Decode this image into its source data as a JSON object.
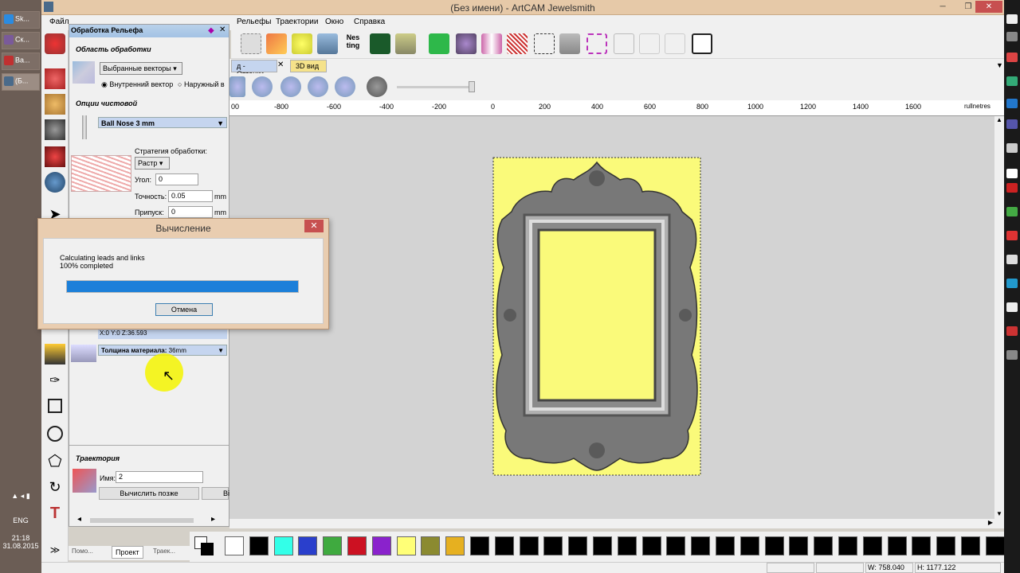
{
  "window": {
    "title": "(Без имени) - ArtCAM Jewelsmith"
  },
  "menu": [
    "Файл",
    "Рельефы",
    "Траектории",
    "Окно",
    "Справка"
  ],
  "taskbar": {
    "items": [
      {
        "label": "Sk...",
        "color": "#2b8be0"
      },
      {
        "label": "Ск...",
        "color": "#7a5a9a"
      },
      {
        "label": "Ва...",
        "color": "#c03030"
      },
      {
        "label": "(Б...",
        "color": "#4a6a8a"
      }
    ],
    "language": "ENG",
    "time": "21:18",
    "date": "31.08.2015"
  },
  "tabs": {
    "shades": "д - Оттенки",
    "view3d": "3D вид"
  },
  "ruler": {
    "ticks": [
      "00",
      "-800",
      "-600",
      "-400",
      "-200",
      "0",
      "200",
      "400",
      "600",
      "800",
      "1000",
      "1200",
      "1400",
      "1600"
    ],
    "unit_label": "rullnetres"
  },
  "panel": {
    "title": "Обработка Рельефа",
    "area_heading": "Область обработки",
    "area_select": "Выбранные векторы",
    "radio_inner": "Внутренний вектор",
    "radio_outer": "Наружный в",
    "finish_heading": "Опции чистовой",
    "tool_name": "Ball Nose 3 mm",
    "strategy_label": "Стратегия обработки:",
    "strategy_value": "Растр",
    "angle_label": "Угол:",
    "angle_value": "0",
    "tolerance_label": "Точность:",
    "tolerance_value": "0.05",
    "tolerance_unit": "mm",
    "allowance_label": "Припуск:",
    "allowance_value": "0",
    "allowance_unit": "mm",
    "coords": "X:0 Y:0 Z:36.593",
    "thickness_label": "Толщина материала:",
    "thickness_value": "36mm",
    "toolpath_heading": "Траектория",
    "name_label": "Имя:",
    "name_value": "2",
    "calc_later_button": "Вычислить позже",
    "calc_button_partial": "Ві"
  },
  "panel_tabs": [
    "Помо...",
    "Проект",
    "Траек..."
  ],
  "dialog": {
    "title": "Вычисление",
    "message_line1": "Calculating leads and links",
    "message_line2": "100% completed",
    "progress": 1.0,
    "cancel_button": "Отмена",
    "accent": "#1c7fd9"
  },
  "status": {
    "width": "W: 758.040",
    "height": "H: 1177.122"
  },
  "palette": {
    "colors": [
      "#ffffff",
      "#000000",
      "#33ffe8",
      "#2a3fcc",
      "#3faa3f",
      "#cc1122",
      "#8a22cc",
      "#ffff77",
      "#8b8a30",
      "#e6b020",
      "#000000",
      "#000000",
      "#000000",
      "#000000",
      "#000000",
      "#000000",
      "#000000",
      "#000000",
      "#000000",
      "#000000",
      "#000000",
      "#000000",
      "#000000",
      "#000000",
      "#000000",
      "#000000",
      "#000000",
      "#000000",
      "#000000",
      "#000000",
      "#000000",
      "#000000"
    ]
  },
  "canvas": {
    "background": "#d3d3d3",
    "material_color": "#fafa7a",
    "frame_color": "#6e6e6e"
  }
}
